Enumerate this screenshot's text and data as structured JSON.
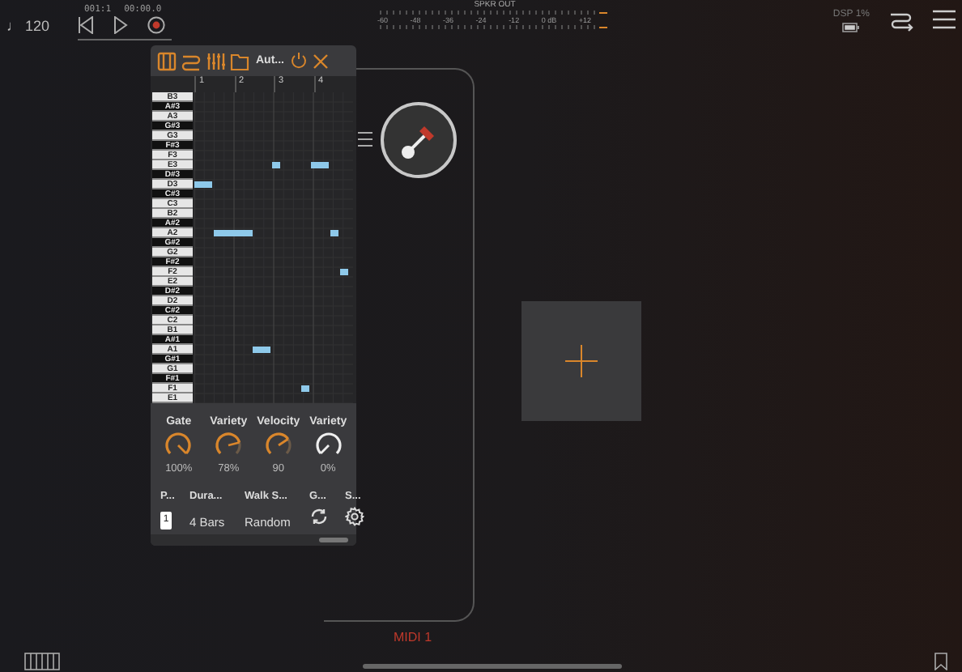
{
  "top_bar": {
    "tempo": "♩ 120",
    "position": "001:1",
    "time": "00:00.0",
    "meter": {
      "title": "SPKR OUT",
      "scale": [
        "-60",
        "-48",
        "-36",
        "-24",
        "-12",
        "0 dB",
        "+12"
      ]
    },
    "dsp": "DSP  1%"
  },
  "plugin": {
    "title": "Aut...",
    "beats": [
      "1",
      "2",
      "3",
      "4"
    ],
    "keys": [
      {
        "label": "B3",
        "black": false
      },
      {
        "label": "A#3",
        "black": true
      },
      {
        "label": "A3",
        "black": false
      },
      {
        "label": "G#3",
        "black": true
      },
      {
        "label": "G3",
        "black": false
      },
      {
        "label": "F#3",
        "black": true
      },
      {
        "label": "F3",
        "black": false
      },
      {
        "label": "E3",
        "black": false
      },
      {
        "label": "D#3",
        "black": true
      },
      {
        "label": "D3",
        "black": false
      },
      {
        "label": "C#3",
        "black": true
      },
      {
        "label": "C3",
        "black": false
      },
      {
        "label": "B2",
        "black": false
      },
      {
        "label": "A#2",
        "black": true
      },
      {
        "label": "A2",
        "black": false
      },
      {
        "label": "G#2",
        "black": true
      },
      {
        "label": "G2",
        "black": false
      },
      {
        "label": "F#2",
        "black": true
      },
      {
        "label": "F2",
        "black": false
      },
      {
        "label": "E2",
        "black": false
      },
      {
        "label": "D#2",
        "black": true
      },
      {
        "label": "D2",
        "black": false
      },
      {
        "label": "C#2",
        "black": true
      },
      {
        "label": "C2",
        "black": false
      },
      {
        "label": "B1",
        "black": false
      },
      {
        "label": "A#1",
        "black": true
      },
      {
        "label": "A1",
        "black": false
      },
      {
        "label": "G#1",
        "black": true
      },
      {
        "label": "G1",
        "black": false
      },
      {
        "label": "F#1",
        "black": true
      },
      {
        "label": "F1",
        "black": false
      },
      {
        "label": "E1",
        "black": false
      }
    ],
    "knobs": [
      {
        "label": "Gate",
        "reading": "100%",
        "kind": "percent"
      },
      {
        "label": "Variety",
        "reading": "78%",
        "kind": "percent"
      },
      {
        "label": "Velocity",
        "reading": "90",
        "kind": "velocity"
      },
      {
        "label": "Variety",
        "reading": "0%",
        "kind": "percent"
      }
    ],
    "settings": [
      {
        "label": "P...",
        "kind": "box",
        "value": "1"
      },
      {
        "label": "Dura...",
        "kind": "text",
        "value": "4 Bars"
      },
      {
        "label": "Walk S...",
        "kind": "text",
        "value": "Random"
      },
      {
        "label": "G...",
        "kind": "refresh"
      },
      {
        "label": "S...",
        "kind": "gear"
      }
    ]
  },
  "track": {
    "name": "MIDI 1"
  }
}
